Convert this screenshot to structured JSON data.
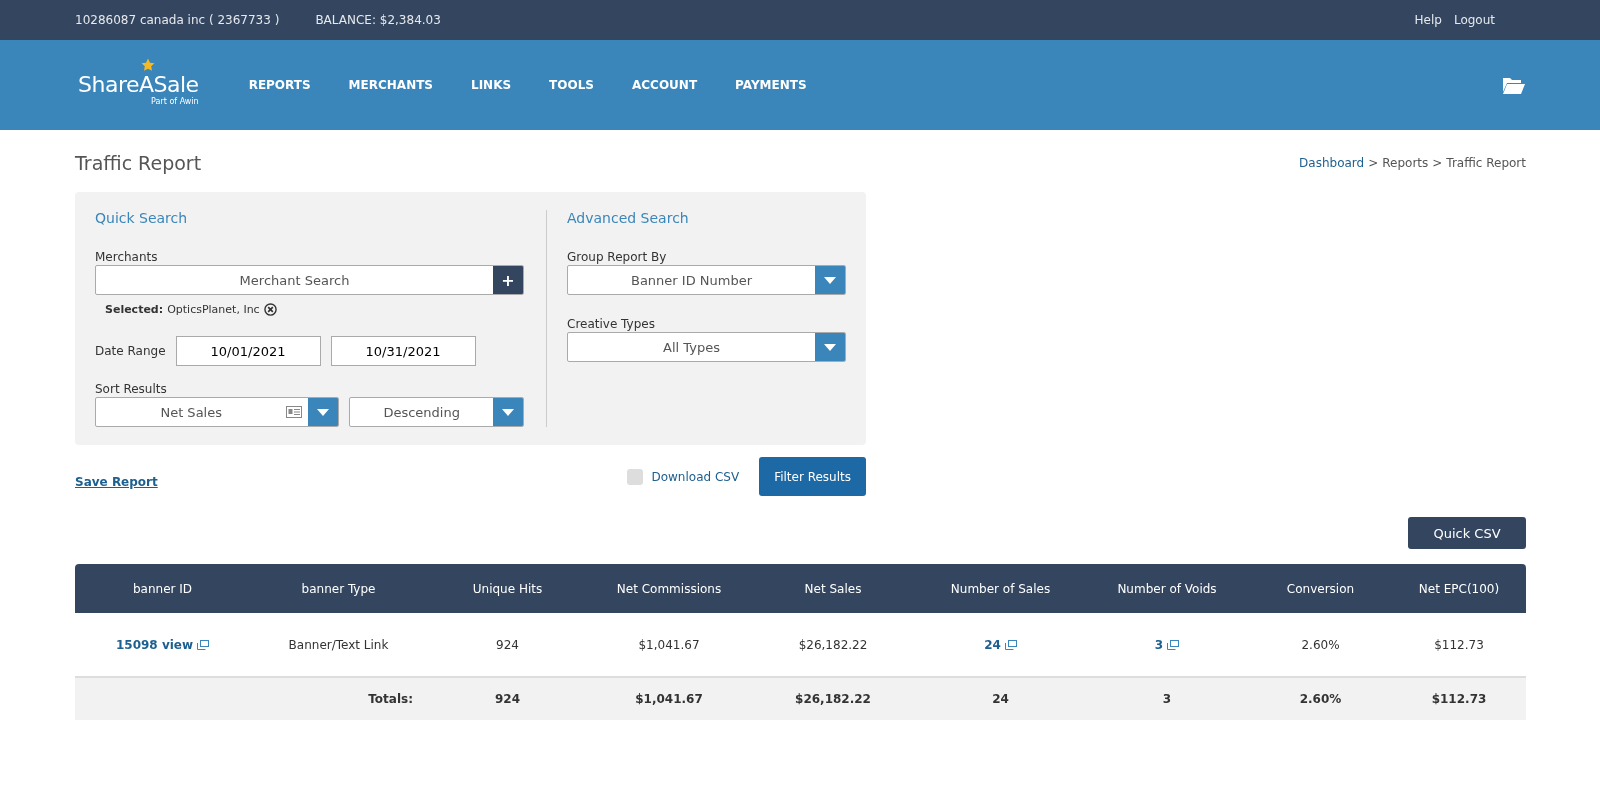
{
  "top_bar": {
    "account": "10286087 canada inc ( 2367733 )",
    "balance": "BALANCE: $2,384.03",
    "links": [
      "Help",
      "Logout"
    ]
  },
  "header": {
    "logo": {
      "name": "ShareASale",
      "tagline": "Part of Awin"
    },
    "nav": [
      "REPORTS",
      "MERCHANTS",
      "LINKS",
      "TOOLS",
      "ACCOUNT",
      "PAYMENTS"
    ]
  },
  "page_title": "Traffic Report",
  "breadcrumb": [
    {
      "label": "Dashboard",
      "link": true
    },
    {
      "label": "Reports",
      "link": false
    },
    {
      "label": "Traffic Report",
      "link": false
    }
  ],
  "breadcrumb_separator": ">",
  "quick_search": {
    "title": "Quick Search",
    "merchants_label": "Merchants",
    "merchant_placeholder": "Merchant Search",
    "add_button": "+",
    "selected_label": "Selected:",
    "selected_value": "OpticsPlanet, Inc",
    "date_label": "Date Range",
    "date_from": "10/01/2021",
    "date_to": "10/31/2021",
    "sort_label": "Sort Results",
    "sort_by": "Net Sales",
    "sort_order": "Descending"
  },
  "advanced_search": {
    "title": "Advanced Search",
    "group_label": "Group Report By",
    "group_value": "Banner ID Number",
    "creative_label": "Creative Types",
    "creative_value": "All Types"
  },
  "actions": {
    "save_report": "Save Report",
    "download_csv": {
      "label": "Download CSV",
      "checked": false
    },
    "filter_button": "Filter Results",
    "quick_csv": "Quick CSV"
  },
  "table": {
    "columns": [
      "banner ID",
      "banner Type",
      "Unique Hits",
      "Net Commissions",
      "Net Sales",
      "Number of Sales",
      "Number of Voids",
      "Conversion",
      "Net EPC(100)"
    ],
    "rows": [
      {
        "cells": [
          {
            "kind": "link",
            "text": "15098 view"
          },
          {
            "kind": "text",
            "text": "Banner/Text Link"
          },
          {
            "kind": "text",
            "text": "924"
          },
          {
            "kind": "text",
            "text": "$1,041.67"
          },
          {
            "kind": "text",
            "text": "$26,182.22"
          },
          {
            "kind": "link",
            "text": "24"
          },
          {
            "kind": "link",
            "text": "3"
          },
          {
            "kind": "text",
            "text": "2.60%"
          },
          {
            "kind": "text",
            "text": "$112.73"
          }
        ]
      }
    ],
    "totals": {
      "label": "Totals:",
      "values": [
        "924",
        "$1,041.67",
        "$26,182.22",
        "24",
        "3",
        "2.60%",
        "$112.73"
      ]
    }
  }
}
